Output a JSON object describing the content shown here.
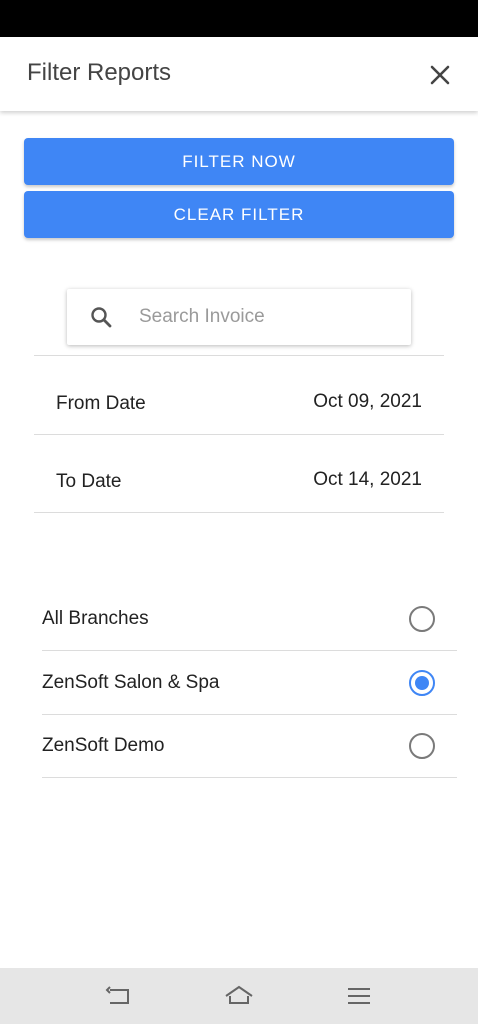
{
  "header": {
    "title": "Filter Reports",
    "close_icon": "close-icon"
  },
  "actions": {
    "filter_now_label": "FILTER NOW",
    "clear_filter_label": "CLEAR FILTER"
  },
  "search": {
    "placeholder": "Search Invoice",
    "value": ""
  },
  "dates": {
    "from_label": "From Date",
    "from_value": "Oct 09, 2021",
    "to_label": "To Date",
    "to_value": "Oct 14, 2021"
  },
  "branches": {
    "items": [
      {
        "label": "All Branches",
        "selected": false
      },
      {
        "label": "ZenSoft Salon & Spa",
        "selected": true
      },
      {
        "label": "ZenSoft Demo",
        "selected": false
      }
    ]
  },
  "colors": {
    "accent": "#3f86f5",
    "status_bar": "#000000",
    "nav_bar": "#e6e6e6"
  },
  "nav": {
    "icons": [
      "back-icon",
      "home-icon",
      "menu-icon"
    ]
  }
}
